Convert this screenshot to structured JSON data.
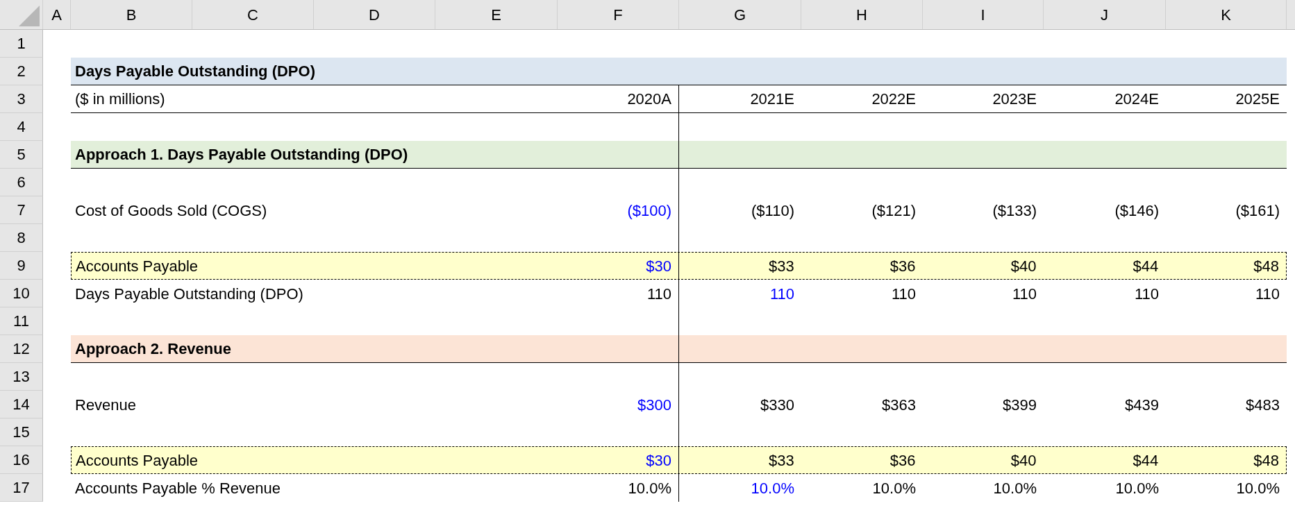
{
  "column_headers": [
    "A",
    "B",
    "C",
    "D",
    "E",
    "F",
    "G",
    "H",
    "I",
    "J",
    "K"
  ],
  "rows": [
    {
      "number": "1",
      "kind": "blank"
    },
    {
      "number": "2",
      "kind": "title",
      "label": "Days Payable Outstanding (DPO)",
      "color": "#dce6f1"
    },
    {
      "number": "3",
      "kind": "units",
      "label": "($ in millions)",
      "values": [
        {
          "text": "2020A",
          "input": false
        },
        {
          "text": "2021E",
          "input": false
        },
        {
          "text": "2022E",
          "input": false
        },
        {
          "text": "2023E",
          "input": false
        },
        {
          "text": "2024E",
          "input": false
        },
        {
          "text": "2025E",
          "input": false
        }
      ]
    },
    {
      "number": "4",
      "kind": "spacer"
    },
    {
      "number": "5",
      "kind": "section",
      "label": "Approach 1. Days Payable Outstanding (DPO)",
      "color": "#e2efda"
    },
    {
      "number": "6",
      "kind": "spacer"
    },
    {
      "number": "7",
      "kind": "item",
      "label": "Cost of Goods Sold (COGS)",
      "values": [
        {
          "text": "($100)",
          "input": true
        },
        {
          "text": "($110)",
          "input": false
        },
        {
          "text": "($121)",
          "input": false
        },
        {
          "text": "($133)",
          "input": false
        },
        {
          "text": "($146)",
          "input": false
        },
        {
          "text": "($161)",
          "input": false
        }
      ]
    },
    {
      "number": "8",
      "kind": "spacer"
    },
    {
      "number": "9",
      "kind": "highlight",
      "label": "Accounts Payable",
      "values": [
        {
          "text": "$30",
          "input": true
        },
        {
          "text": "$33",
          "input": false
        },
        {
          "text": "$36",
          "input": false
        },
        {
          "text": "$40",
          "input": false
        },
        {
          "text": "$44",
          "input": false
        },
        {
          "text": "$48",
          "input": false
        }
      ]
    },
    {
      "number": "10",
      "kind": "item",
      "label": "Days Payable Outstanding (DPO)",
      "values": [
        {
          "text": "110",
          "input": false
        },
        {
          "text": "110",
          "input": true
        },
        {
          "text": "110",
          "input": false
        },
        {
          "text": "110",
          "input": false
        },
        {
          "text": "110",
          "input": false
        },
        {
          "text": "110",
          "input": false
        }
      ]
    },
    {
      "number": "11",
      "kind": "spacer"
    },
    {
      "number": "12",
      "kind": "section",
      "label": "Approach 2. Revenue",
      "color": "#fce4d6"
    },
    {
      "number": "13",
      "kind": "spacer"
    },
    {
      "number": "14",
      "kind": "item",
      "label": "Revenue",
      "values": [
        {
          "text": "$300",
          "input": true
        },
        {
          "text": "$330",
          "input": false
        },
        {
          "text": "$363",
          "input": false
        },
        {
          "text": "$399",
          "input": false
        },
        {
          "text": "$439",
          "input": false
        },
        {
          "text": "$483",
          "input": false
        }
      ]
    },
    {
      "number": "15",
      "kind": "spacer"
    },
    {
      "number": "16",
      "kind": "highlight",
      "label": "Accounts Payable",
      "values": [
        {
          "text": "$30",
          "input": true
        },
        {
          "text": "$33",
          "input": false
        },
        {
          "text": "$36",
          "input": false
        },
        {
          "text": "$40",
          "input": false
        },
        {
          "text": "$44",
          "input": false
        },
        {
          "text": "$48",
          "input": false
        }
      ]
    },
    {
      "number": "17",
      "kind": "item",
      "label": "Accounts Payable % Revenue",
      "values": [
        {
          "text": "10.0%",
          "input": false
        },
        {
          "text": "10.0%",
          "input": true
        },
        {
          "text": "10.0%",
          "input": false
        },
        {
          "text": "10.0%",
          "input": false
        },
        {
          "text": "10.0%",
          "input": false
        },
        {
          "text": "10.0%",
          "input": false
        }
      ]
    }
  ]
}
